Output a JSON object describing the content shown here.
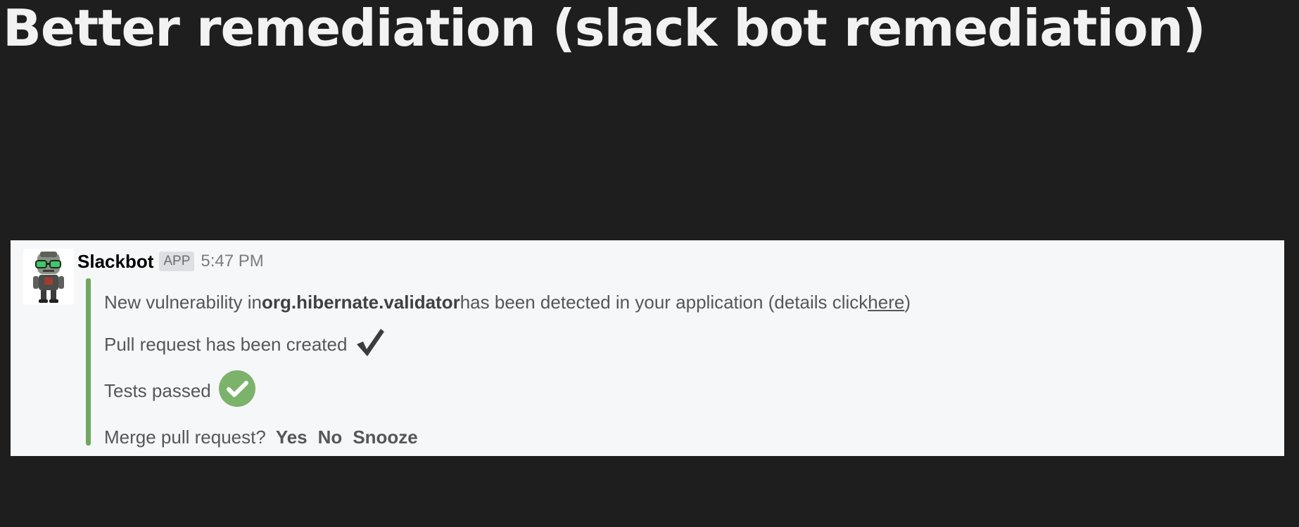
{
  "slide": {
    "title": "Better remediation (slack bot remediation)"
  },
  "message": {
    "sender": "Slackbot",
    "badge": "APP",
    "time": "5:47 PM",
    "line1": {
      "prefix": "New vulnerability in ",
      "package": "org.hibernate.validator",
      "middle": " has been detected in your application (details click ",
      "link": "here",
      "suffix": ")"
    },
    "line2": "Pull request has been created",
    "line3": "Tests passed",
    "line4": {
      "question": "Merge pull request?",
      "actions": [
        "Yes",
        "No",
        "Snooze"
      ]
    }
  },
  "colors": {
    "background": "#1e1e1e",
    "card": "#f6f7f9",
    "accent_bar": "#6fa85e",
    "success_circle": "#7bb36a"
  },
  "icons": {
    "avatar": "robot-avatar-icon",
    "checkmark": "checkmark-icon",
    "check_circle": "check-circle-icon"
  }
}
